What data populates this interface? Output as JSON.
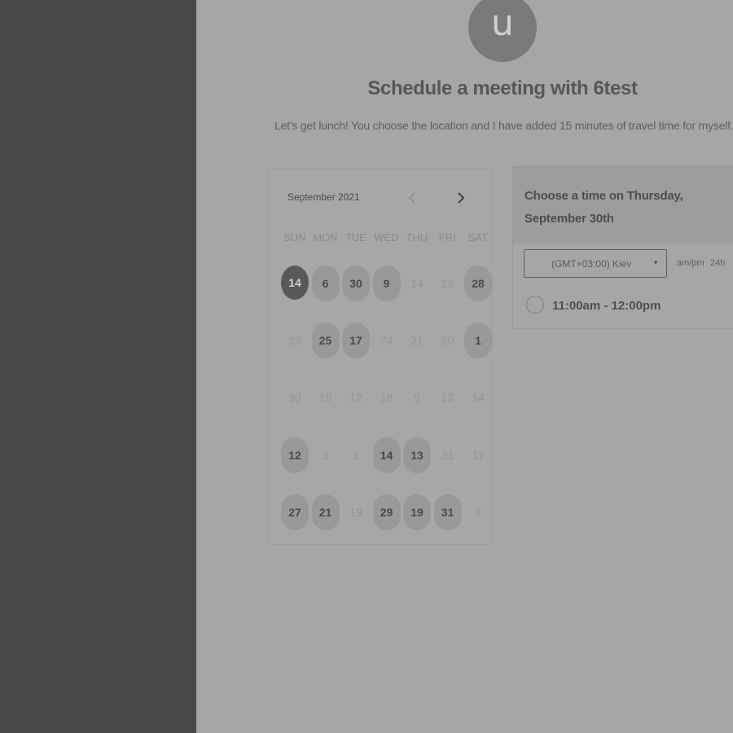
{
  "host": {
    "avatar_letter": "u",
    "title": "Schedule a meeting with 6test",
    "description": "Let's get lunch! You choose the location and I have added 15 minutes of travel time for myself."
  },
  "calendar": {
    "month_label": "September 2021",
    "weekdays": [
      "SUN",
      "MON",
      "TUE",
      "WED",
      "THU",
      "FRI",
      "SAT"
    ],
    "weeks": [
      [
        {
          "d": "14",
          "s": "selected"
        },
        {
          "d": "6",
          "s": "available"
        },
        {
          "d": "30",
          "s": "available"
        },
        {
          "d": "9",
          "s": "available"
        },
        {
          "d": "14",
          "s": "disabled"
        },
        {
          "d": "19",
          "s": "disabled"
        },
        {
          "d": "28",
          "s": "available"
        }
      ],
      [
        {
          "d": "23",
          "s": "disabled"
        },
        {
          "d": "25",
          "s": "available"
        },
        {
          "d": "17",
          "s": "available"
        },
        {
          "d": "24",
          "s": "disabled"
        },
        {
          "d": "21",
          "s": "disabled"
        },
        {
          "d": "20",
          "s": "disabled"
        },
        {
          "d": "1",
          "s": "available"
        }
      ],
      [
        {
          "d": "30",
          "s": "disabled"
        },
        {
          "d": "19",
          "s": "disabled"
        },
        {
          "d": "12",
          "s": "disabled"
        },
        {
          "d": "18",
          "s": "disabled"
        },
        {
          "d": "9",
          "s": "disabled"
        },
        {
          "d": "13",
          "s": "disabled"
        },
        {
          "d": "14",
          "s": "disabled"
        }
      ],
      [
        {
          "d": "12",
          "s": "available"
        },
        {
          "d": "3",
          "s": "disabled"
        },
        {
          "d": "1",
          "s": "disabled"
        },
        {
          "d": "14",
          "s": "available"
        },
        {
          "d": "13",
          "s": "available"
        },
        {
          "d": "31",
          "s": "disabled"
        },
        {
          "d": "17",
          "s": "disabled"
        }
      ],
      [
        {
          "d": "27",
          "s": "available"
        },
        {
          "d": "21",
          "s": "available"
        },
        {
          "d": "19",
          "s": "disabled"
        },
        {
          "d": "29",
          "s": "available"
        },
        {
          "d": "19",
          "s": "available"
        },
        {
          "d": "31",
          "s": "available"
        },
        {
          "d": "8",
          "s": "disabled"
        }
      ]
    ]
  },
  "time_panel": {
    "heading_line1": "Choose a time on Thursday,",
    "heading_line2": "September 30th",
    "timezone": "(GMT+03:00) Kiev",
    "format_ampm": "am/pm",
    "format_24h": "24h",
    "slots": [
      "11:00am - 12:00pm"
    ]
  },
  "icons": {
    "prev": "chevron-left-icon",
    "next": "chevron-right-icon",
    "dropdown": "caret-down-icon"
  }
}
